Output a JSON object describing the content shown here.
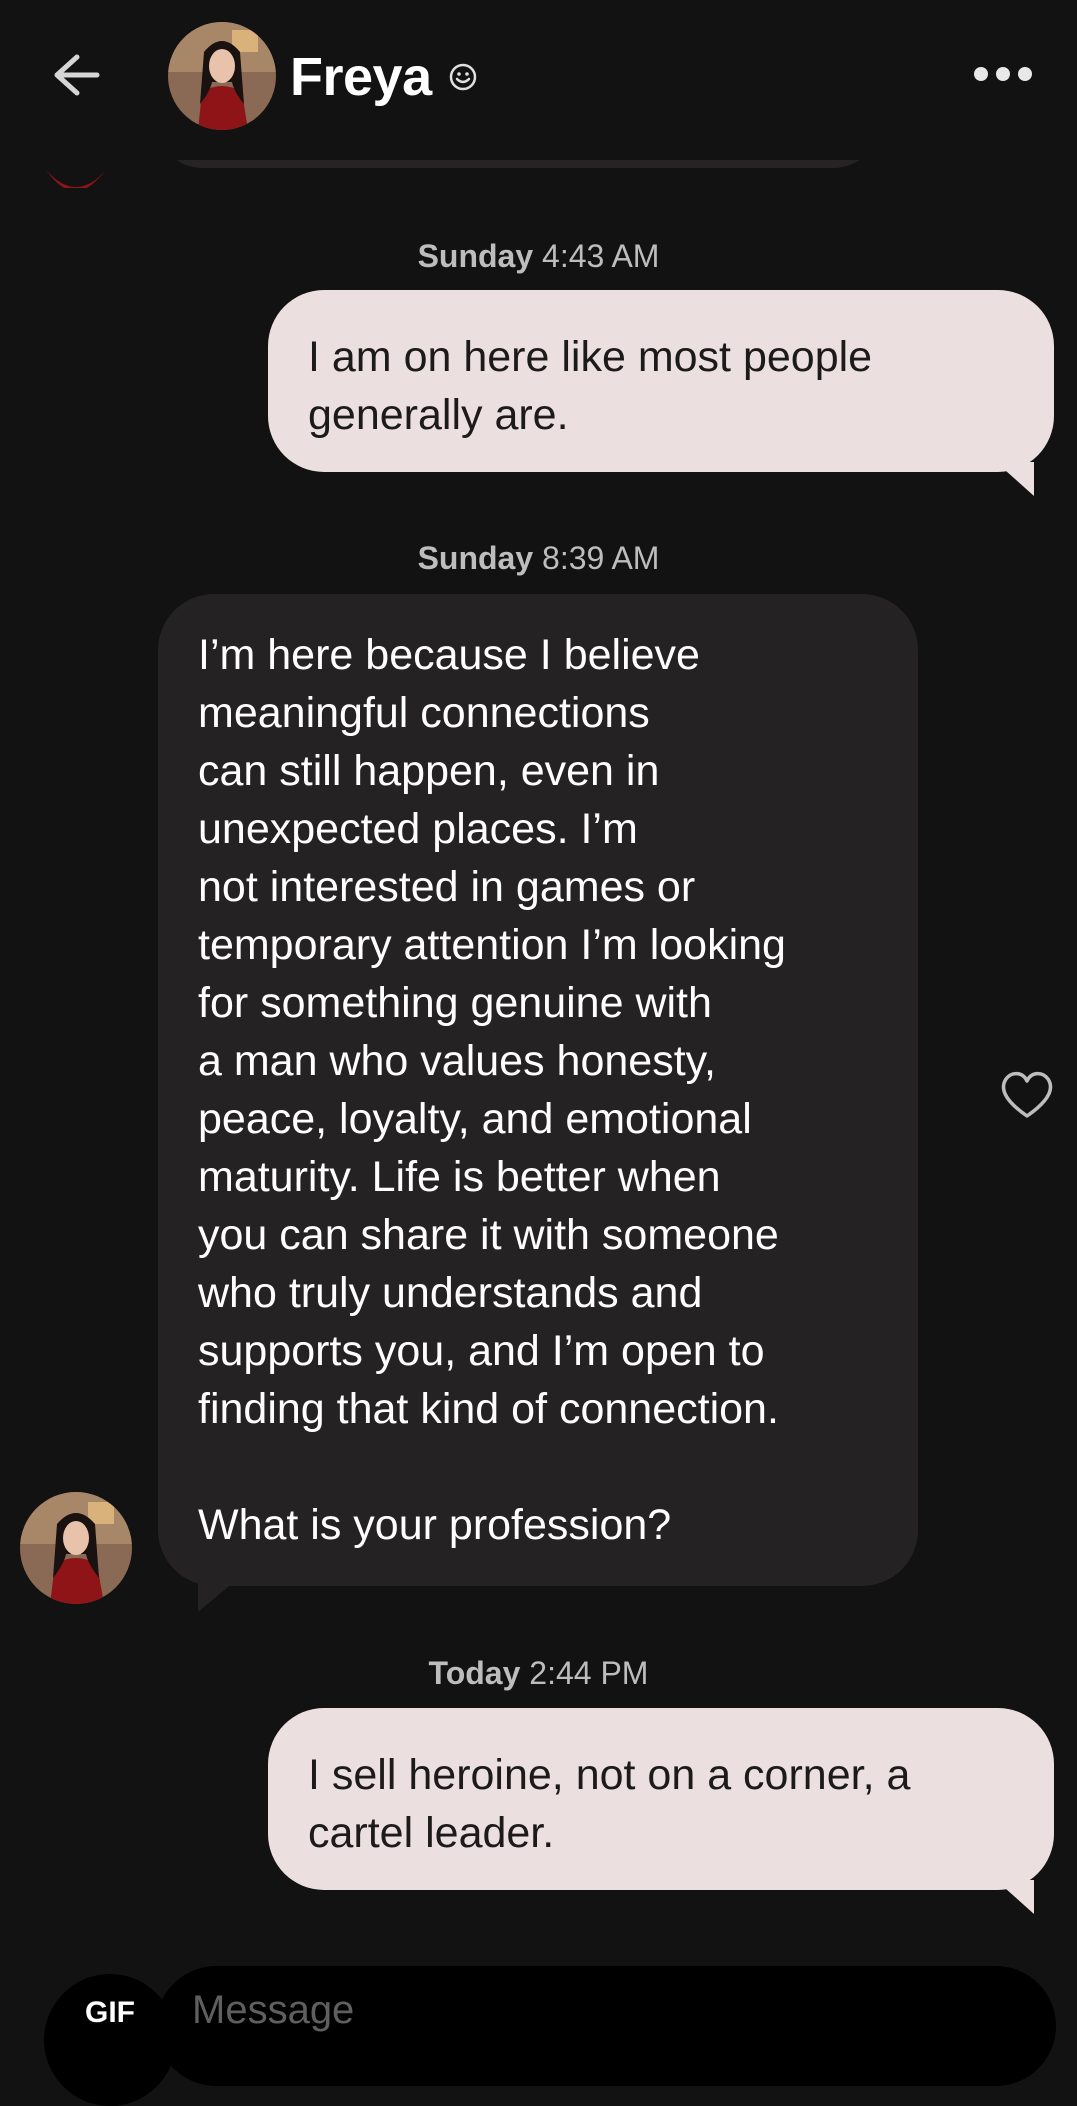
{
  "header": {
    "contact_name": "Freya",
    "back_icon": "arrow-left-icon",
    "verified_icon": "verified-face-icon",
    "more_icon": "more-horizontal-icon"
  },
  "messages": [
    {
      "timestamp_day": "Sunday",
      "timestamp_time": "4:43 AM",
      "direction": "sent",
      "lines": [
        "I am on here like most people",
        "generally are."
      ]
    },
    {
      "timestamp_day": "Sunday",
      "timestamp_time": "8:39 AM",
      "direction": "received",
      "lines": [
        "I’m here because I believe",
        "meaningful connections",
        "can still happen, even in",
        "unexpected places. I’m",
        "not interested in games or",
        "temporary attention I’m looking",
        "for something genuine with",
        "a man who values honesty,",
        "peace, loyalty, and emotional",
        "maturity. Life is better when",
        "you can share it with someone",
        "who truly understands and",
        "supports you, and I’m open to",
        "finding that kind of connection.",
        "",
        "What is your profession?"
      ]
    },
    {
      "timestamp_day": "Today",
      "timestamp_time": "2:44 PM",
      "direction": "sent",
      "lines": [
        "I sell heroine, not on a corner, a",
        "cartel leader."
      ]
    }
  ],
  "composer": {
    "gif_label": "GIF",
    "placeholder": "Message"
  },
  "colors": {
    "background": "#121212",
    "sent_bubble": "#ebe0df",
    "received_bubble": "#242222",
    "timestamp_text": "#bdbdbd"
  }
}
